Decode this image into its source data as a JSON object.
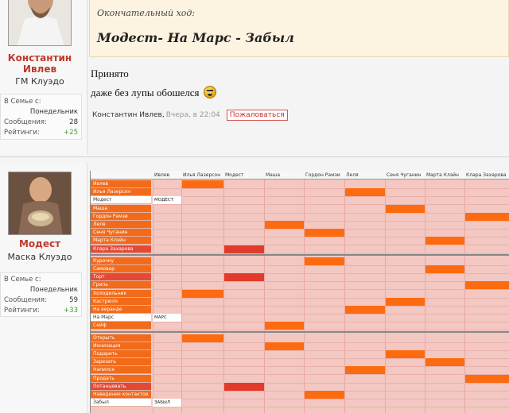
{
  "colors": {
    "orange": "#fd6b10",
    "red": "#e23b2b",
    "pink": "#f3c7c2",
    "name_red": "#c0392b",
    "green": "#4a9a2a"
  },
  "post1": {
    "user": {
      "name": "Константин Ивлев",
      "rank": "ГМ Клуэдо",
      "stats": [
        {
          "label": "В Семье с:",
          "value": ""
        },
        {
          "label": "",
          "value": "Понедельник"
        },
        {
          "label": "Сообщения:",
          "value": "28"
        },
        {
          "label": "Рейтинги:",
          "value": "+25"
        }
      ]
    },
    "quote_title": "Окончательный ход:",
    "quote_text": "Модест- На Марс - Забыл",
    "line1": "Принято",
    "line2": "даже без лупы обошелся",
    "author": "Константин Ивлев,",
    "time": "Вчера, в 22:04",
    "report_label": "Пожаловаться",
    "smiley_icon": "smiley-icon"
  },
  "post2": {
    "user": {
      "name": "Модест",
      "rank": "Маска Клуэдо",
      "stats": [
        {
          "label": "В Семье с:",
          "value": ""
        },
        {
          "label": "",
          "value": "Понедельник"
        },
        {
          "label": "Сообщения:",
          "value": "59"
        },
        {
          "label": "Рейтинги:",
          "value": "+33"
        }
      ]
    }
  },
  "sheet": {
    "headers": [
      "Ивлев",
      "Илья Лазерсон",
      "Модест",
      "Маша",
      "Гордон Рамзи",
      "Леля",
      "Сеня Чуганин",
      "Марта Клэйн",
      "Клара Захарова"
    ],
    "sections": [
      {
        "rows": [
          {
            "label": "Ивлев",
            "style": "orange",
            "answer": "",
            "col": 1,
            "mark": "o"
          },
          {
            "label": "Илья Лазерсон",
            "style": "orange",
            "answer": "",
            "col": 5,
            "mark": "o"
          },
          {
            "label": "Модест",
            "style": "white",
            "answer": "МОДЕСТ",
            "col": -1,
            "mark": ""
          },
          {
            "label": "Маша",
            "style": "orange",
            "answer": "",
            "col": 6,
            "mark": "o"
          },
          {
            "label": "Гордон Рамзи",
            "style": "orange",
            "answer": "",
            "col": 8,
            "mark": "o"
          },
          {
            "label": "Леля",
            "style": "orange",
            "answer": "",
            "col": 3,
            "mark": "o"
          },
          {
            "label": "Сеня Чуганин",
            "style": "orange",
            "answer": "",
            "col": 4,
            "mark": "o"
          },
          {
            "label": "Марта Клэйн",
            "style": "orange",
            "answer": "",
            "col": 7,
            "mark": "o"
          },
          {
            "label": "Клара Захарова",
            "style": "red",
            "answer": "",
            "col": 2,
            "mark": "r"
          }
        ]
      },
      {
        "rows": [
          {
            "label": "Курочку",
            "style": "orange",
            "answer": "",
            "col": 4,
            "mark": "o"
          },
          {
            "label": "Самовар",
            "style": "orange",
            "answer": "",
            "col": 7,
            "mark": "o"
          },
          {
            "label": "Торт",
            "style": "red",
            "answer": "",
            "col": 2,
            "mark": "r"
          },
          {
            "label": "Гриль",
            "style": "orange",
            "answer": "",
            "col": 8,
            "mark": "o"
          },
          {
            "label": "Холодильник",
            "style": "orange",
            "answer": "",
            "col": 1,
            "mark": "o"
          },
          {
            "label": "Кастрюля",
            "style": "orange",
            "answer": "",
            "col": 6,
            "mark": "o"
          },
          {
            "label": "На веранде",
            "style": "orange",
            "answer": "",
            "col": 5,
            "mark": "o"
          },
          {
            "label": "На Марс",
            "style": "white",
            "answer": "МАРС",
            "col": -1,
            "mark": ""
          },
          {
            "label": "Сейф",
            "style": "orange",
            "answer": "",
            "col": 3,
            "mark": "o"
          }
        ]
      },
      {
        "rows": [
          {
            "label": "Открыть",
            "style": "orange",
            "answer": "",
            "col": 1,
            "mark": "o"
          },
          {
            "label": "Ионизация",
            "style": "orange",
            "answer": "",
            "col": 3,
            "mark": "o"
          },
          {
            "label": "Подарить",
            "style": "orange",
            "answer": "",
            "col": 6,
            "mark": "o"
          },
          {
            "label": "Зарезать",
            "style": "orange",
            "answer": "",
            "col": 7,
            "mark": "o"
          },
          {
            "label": "Напился",
            "style": "orange",
            "answer": "",
            "col": 5,
            "mark": "o"
          },
          {
            "label": "Продать",
            "style": "orange",
            "answer": "",
            "col": 8,
            "mark": "o"
          },
          {
            "label": "Потанцевать",
            "style": "red",
            "answer": "",
            "col": 2,
            "mark": "r"
          },
          {
            "label": "Наведение контактов",
            "style": "orange",
            "answer": "",
            "col": 4,
            "mark": "o"
          },
          {
            "label": "Забыл",
            "style": "white",
            "answer": "ЗАБЫЛ",
            "col": -1,
            "mark": ""
          }
        ]
      }
    ]
  }
}
